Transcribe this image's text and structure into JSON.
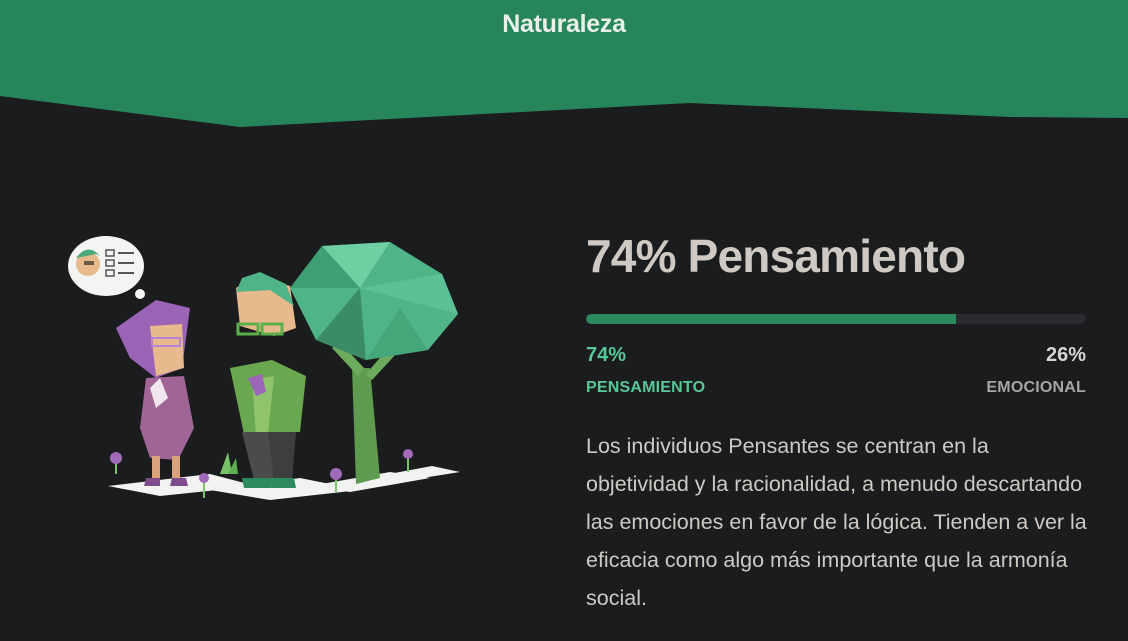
{
  "section": {
    "title": "Naturaleza"
  },
  "colors": {
    "header_green": "#27855b",
    "accent_green": "#58c898",
    "bar_fill": "#2a8a5e",
    "background": "#1b1c1e",
    "text": "#cfc9c4"
  },
  "trait": {
    "headline": "74% Pensamiento",
    "progress_fraction": 0.74,
    "left": {
      "percent": "74%",
      "label": "PENSAMIENTO"
    },
    "right": {
      "percent": "26%",
      "label": "EMOCIONAL"
    },
    "description": "Los individuos Pensantes se centran en la objetividad y la racionalidad, a menudo descartando las emociones en favor de la lógica. Tienden a ver la eficacia como algo más importante que la armonía social."
  },
  "illustration": {
    "icons": [
      "thought-bubble-icon",
      "checklist-icon",
      "tree-icon",
      "flower-icon"
    ]
  }
}
